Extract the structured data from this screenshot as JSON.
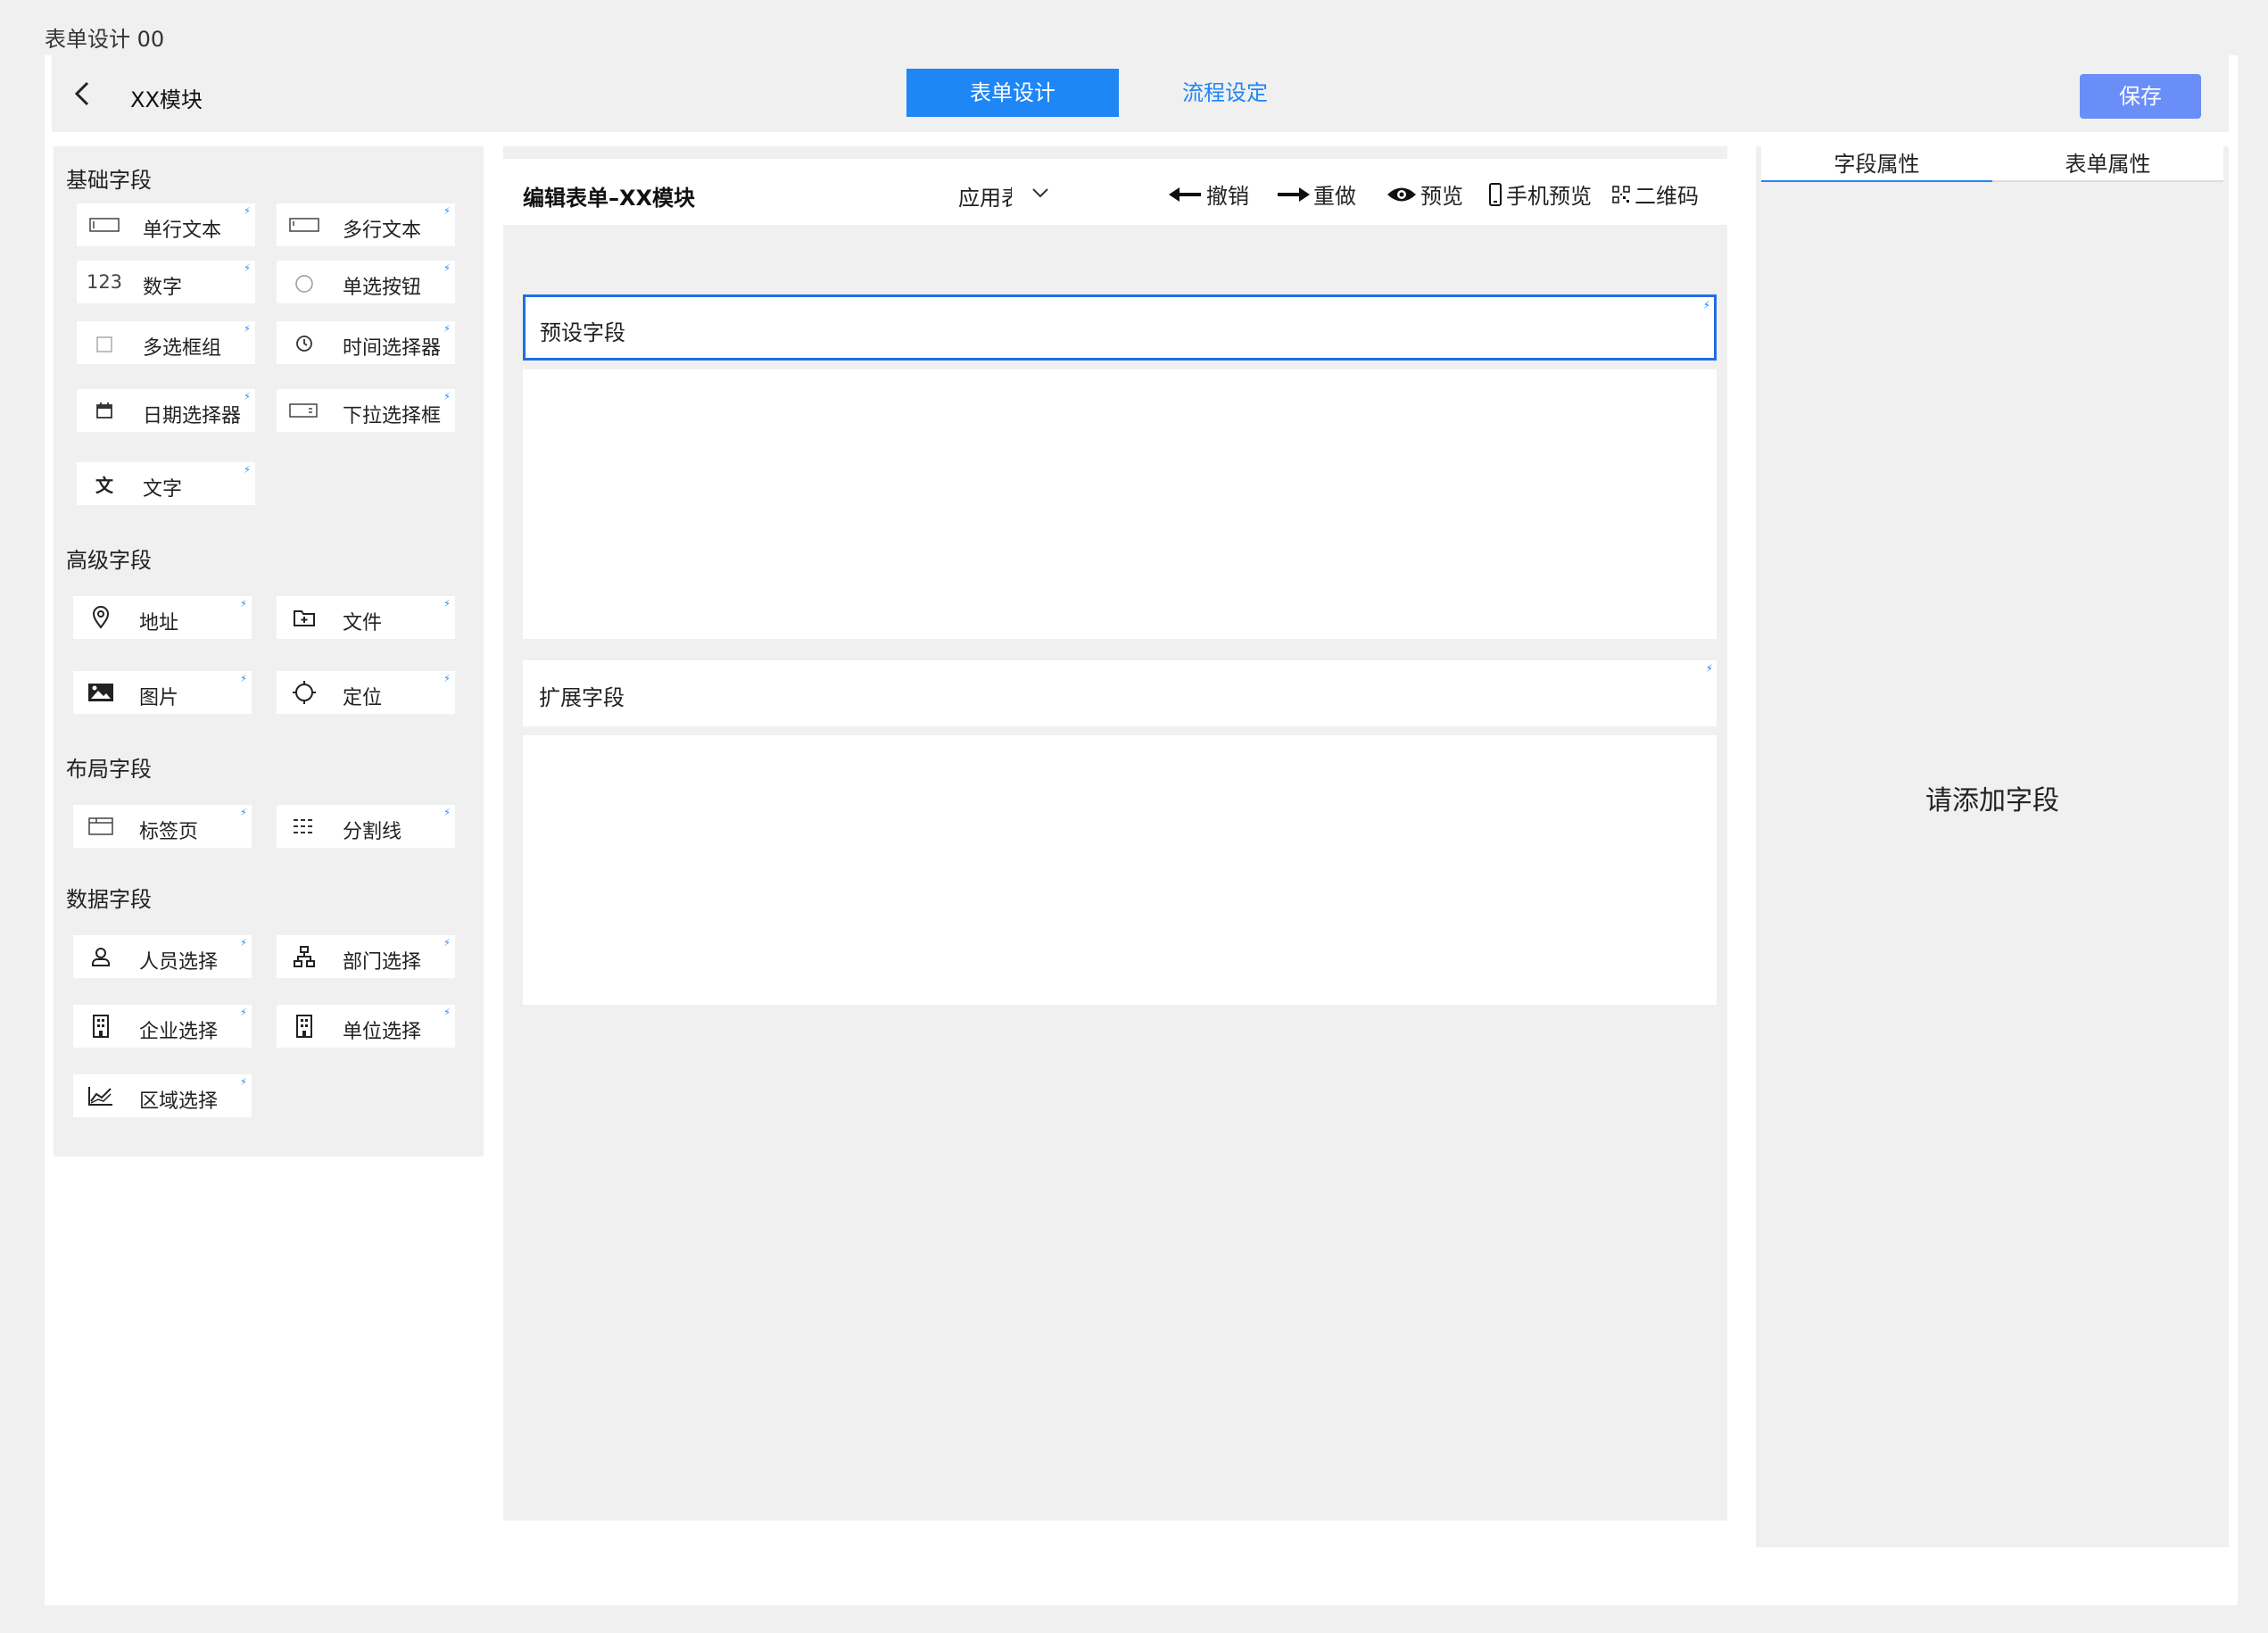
{
  "page_title": "表单设计 00",
  "header": {
    "module_name": "XX模块",
    "tabs": [
      "表单设计",
      "流程设定"
    ],
    "save_label": "保存"
  },
  "left_panel": {
    "sections": [
      {
        "title": "基础字段",
        "fields": [
          "单行文本",
          "多行文本",
          "数字",
          "单选按钮",
          "多选框组",
          "时间选择器",
          "日期选择器",
          "下拉选择框",
          "文字"
        ]
      },
      {
        "title": "高级字段",
        "fields": [
          "地址",
          "文件",
          "图片",
          "定位"
        ]
      },
      {
        "title": "布局字段",
        "fields": [
          "标签页",
          "分割线"
        ]
      },
      {
        "title": "数据字段",
        "fields": [
          "人员选择",
          "部门选择",
          "企业选择",
          "单位选择",
          "区域选择"
        ]
      }
    ],
    "number_icon_text": "123"
  },
  "toolbar": {
    "title": "编辑表单–XX模块",
    "select_value": "应用表",
    "undo": "撤销",
    "redo": "重做",
    "preview": "预览",
    "mobile_preview": "手机预览",
    "qrcode": "二维码"
  },
  "canvas": {
    "preset_label": "预设字段",
    "extension_label": "扩展字段"
  },
  "right_panel": {
    "tabs": [
      "字段属性",
      "表单属性"
    ],
    "empty_text": "请添加字段"
  },
  "colors": {
    "accent": "#1f86f6",
    "save_button": "#6a8ef7",
    "selected_border": "#1f6fe0"
  }
}
